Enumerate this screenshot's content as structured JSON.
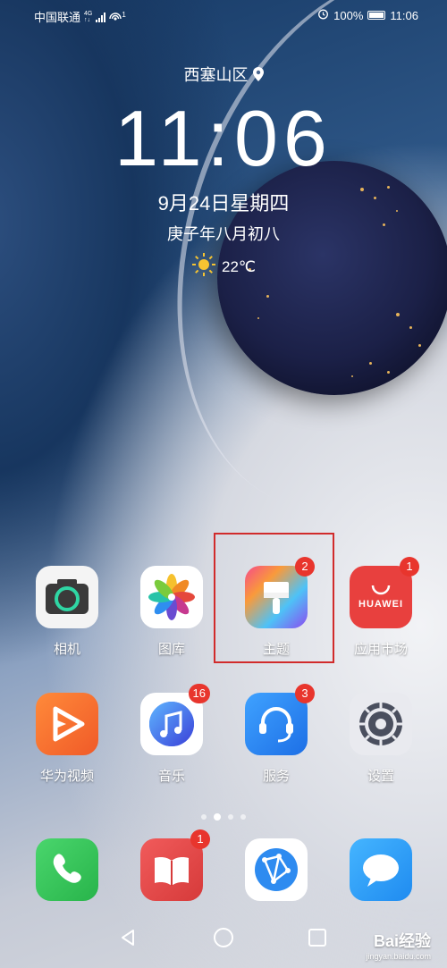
{
  "status_bar": {
    "carrier": "中国联通",
    "network_top": "4G",
    "network_bottom": "↑↓",
    "hotspot_badge": "1",
    "battery": "100%",
    "time": "11:06"
  },
  "lockscreen": {
    "location": "西塞山区",
    "clock": "11:06",
    "date": "9月24日星期四",
    "lunar": "庚子年八月初八",
    "temperature": "22℃"
  },
  "apps_row1": [
    {
      "label": "相机",
      "icon": "camera-icon"
    },
    {
      "label": "图库",
      "icon": "gallery-icon"
    },
    {
      "label": "主题",
      "icon": "themes-brush-icon",
      "badge": "2"
    },
    {
      "label": "应用市场",
      "icon": "appgallery-icon",
      "badge": "1",
      "brand": "HUAWEI"
    }
  ],
  "apps_row2": [
    {
      "label": "华为视频",
      "icon": "video-icon"
    },
    {
      "label": "音乐",
      "icon": "music-icon",
      "badge": "16"
    },
    {
      "label": "服务",
      "icon": "service-headset-icon",
      "badge": "3"
    },
    {
      "label": "设置",
      "icon": "settings-gear-icon"
    }
  ],
  "dock": [
    {
      "icon": "phone-icon"
    },
    {
      "icon": "book-icon",
      "badge": "1"
    },
    {
      "icon": "browser-icon"
    },
    {
      "icon": "messages-icon"
    }
  ],
  "page_indicator": {
    "pages": 4,
    "active": 1
  },
  "watermark": {
    "line1": "Bai经验",
    "line2": "jingyan.baidu.com"
  },
  "colors": {
    "highlight": "#d12b2b",
    "badge": "#e8352d"
  }
}
